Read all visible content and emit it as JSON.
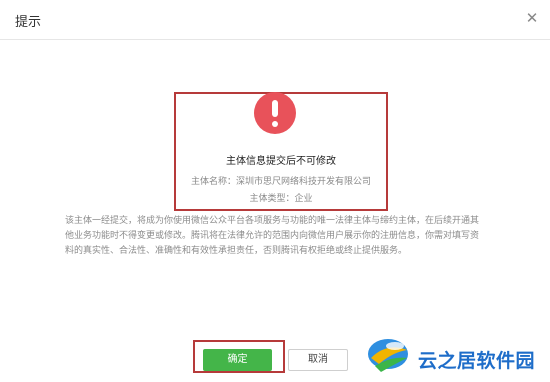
{
  "dialog": {
    "title": "提示",
    "close_icon": "close-icon"
  },
  "alert": {
    "icon": "exclamation-icon",
    "heading": "主体信息提交后不可修改",
    "entity_name_line": "主体名称：深圳市思尺网络科技开发有限公司",
    "entity_type_line": "主体类型：企业"
  },
  "description": "该主体一经提交，将成为你使用微信公众平台各项服务与功能的唯一法律主体与缔约主体，在后续开通其他业务功能时不得变更或修改。腾讯将在法律允许的范围内向微信用户展示你的注册信息，你需对填写资料的真实性、合法性、准确性和有效性承担责任，否则腾讯有权拒绝或终止提供服务。",
  "buttons": {
    "confirm": "确定",
    "cancel": "取消"
  },
  "watermark": {
    "text": "云之居软件园"
  },
  "colors": {
    "confirm_green": "#44b549",
    "highlight_red": "#b63a3a",
    "warning_red": "#e8525a",
    "watermark_blue": "#1e6dc9"
  }
}
